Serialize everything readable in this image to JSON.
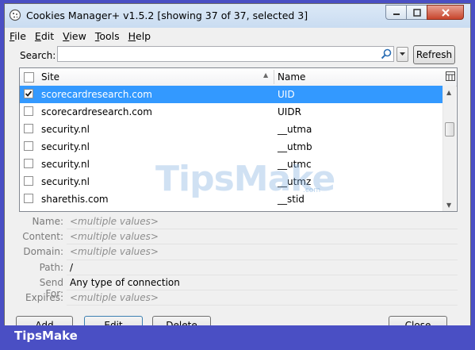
{
  "window": {
    "title": "Cookies Manager+ v1.5.2 [showing 37 of 37, selected 3]"
  },
  "menu": [
    {
      "label": "File",
      "key": "F",
      "rest": "ile"
    },
    {
      "label": "Edit",
      "key": "E",
      "rest": "dit"
    },
    {
      "label": "View",
      "key": "V",
      "rest": "iew"
    },
    {
      "label": "Tools",
      "key": "T",
      "rest": "ools"
    },
    {
      "label": "Help",
      "key": "H",
      "rest": "elp"
    }
  ],
  "search": {
    "label": "Search:",
    "value": "",
    "refresh_label": "Refresh"
  },
  "table": {
    "columns": [
      "Site",
      "Name"
    ],
    "rows": [
      {
        "site": "scorecardresearch.com",
        "name": "UID",
        "checked": true,
        "selected": true
      },
      {
        "site": "scorecardresearch.com",
        "name": "UIDR",
        "checked": false,
        "selected": false
      },
      {
        "site": "security.nl",
        "name": "__utma",
        "checked": false,
        "selected": false
      },
      {
        "site": "security.nl",
        "name": "__utmb",
        "checked": false,
        "selected": false
      },
      {
        "site": "security.nl",
        "name": "__utmc",
        "checked": false,
        "selected": false
      },
      {
        "site": "security.nl",
        "name": "__utmz",
        "checked": false,
        "selected": false
      },
      {
        "site": "sharethis.com",
        "name": "__stid",
        "checked": false,
        "selected": false
      }
    ]
  },
  "details": [
    {
      "label": "Name:",
      "value": "<multiple values>",
      "muted": true
    },
    {
      "label": "Content:",
      "value": "<multiple values>",
      "muted": true
    },
    {
      "label": "Domain:",
      "value": "<multiple values>",
      "muted": true
    },
    {
      "label": "Path:",
      "value": "/",
      "muted": false
    },
    {
      "label": "Send For:",
      "value": "Any type of connection",
      "muted": false
    },
    {
      "label": "Expires:",
      "value": "<multiple values>",
      "muted": true
    }
  ],
  "buttons": {
    "add": "Add",
    "edit": "Edit",
    "delete": "Delete",
    "close": "Close"
  },
  "watermark": {
    "text": "TipsMake",
    "sub": ".com"
  },
  "footer": {
    "brand": "TipsMake"
  },
  "colors": {
    "selection": "#3399ff",
    "frame": "#4a4fc4",
    "close_button": "#c8452c"
  }
}
